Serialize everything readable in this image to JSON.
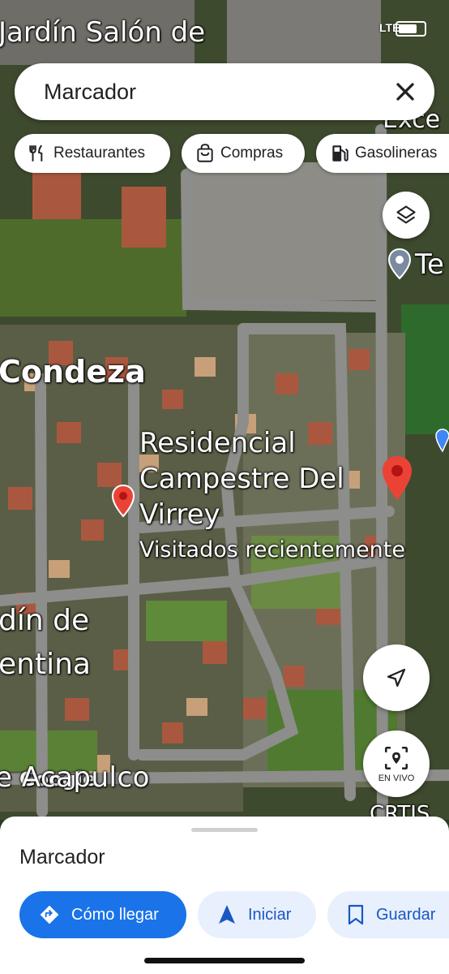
{
  "status_bar": {
    "network": "LTE"
  },
  "search": {
    "value": "Marcador"
  },
  "chips": [
    {
      "label": "Restaurantes",
      "icon": "fork-knife-icon"
    },
    {
      "label": "Compras",
      "icon": "shopping-bag-icon"
    },
    {
      "label": "Gasolineras",
      "icon": "gas-station-icon"
    }
  ],
  "map_labels": {
    "top_label": "Jardín Salón de",
    "top_right_fragment": "Exce",
    "te_fragment": "Te",
    "condeza": "Condeza",
    "residencial_line1": "Residencial",
    "residencial_line2": "Campestre Del",
    "residencial_line3": "Virrey",
    "recent": "Visitados recientemente",
    "jardin_line1": "dín de",
    "jardin_line2": "entina",
    "acapulco": "e Acapulco",
    "google": "Google",
    "bottom_right": "CRTIS"
  },
  "controls": {
    "live_view_label": "EN VIVO"
  },
  "sheet": {
    "title": "Marcador",
    "buttons": {
      "directions": "Cómo llegar",
      "start": "Iniciar",
      "save": "Guardar"
    }
  },
  "colors": {
    "accent": "#1a73e8",
    "pin": "#ea4335",
    "secondary_bg": "#e8f0fe"
  }
}
